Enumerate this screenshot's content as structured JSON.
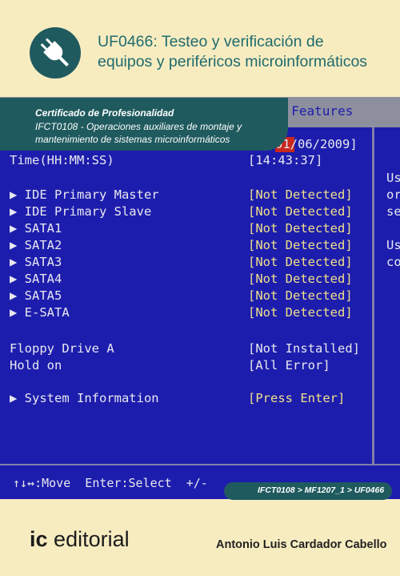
{
  "title": "UF0466: Testeo y verificación de equipos y periféricos microinformáticos",
  "title_line1": "UF0466: Testeo y verificación de",
  "title_line2": "equipos y periféricos microinformáticos",
  "certificate": {
    "heading": "Certificado de Profesionalidad",
    "line1": "IFCT0108 -  Operaciones auxiliares de montaje y",
    "line2": "mantenimiento de sistemas microinformáticos"
  },
  "bios": {
    "header": "S Features",
    "date_value": "01/06/2009]",
    "time_label": "Time(HH:MM:SS)",
    "time_value": "[14:43:37]",
    "rows": [
      {
        "label": "▶ IDE Primary Master",
        "value": "[Not Detected]"
      },
      {
        "label": "▶ IDE Primary Slave",
        "value": "[Not Detected]"
      },
      {
        "label": "▶ SATA1",
        "value": "[Not Detected]"
      },
      {
        "label": "▶ SATA2",
        "value": "[Not Detected]"
      },
      {
        "label": "▶ SATA3",
        "value": "[Not Detected]"
      },
      {
        "label": "▶ SATA4",
        "value": "[Not Detected]"
      },
      {
        "label": "▶ SATA5",
        "value": "[Not Detected]"
      },
      {
        "label": "▶ E-SATA",
        "value": "[Not Detected]"
      }
    ],
    "floppy_label": "Floppy Drive A",
    "floppy_value": "[Not Installed]",
    "hold_label": "Hold on",
    "hold_value": "[All Error]",
    "sysinfo_label": "▶ System Information",
    "sysinfo_value": "[Press Enter]",
    "help_fragments": [
      "Us",
      "or",
      "se",
      "Us",
      "co"
    ],
    "footer": "↑↓↔:Move  Enter:Select  +/-"
  },
  "breadcrumb": "IFCT0108 > MF1207_1 > UF0466",
  "publisher": {
    "prefix": "ic",
    "name": "editorial"
  },
  "author": "Antonio Luis Cardador Cabello",
  "colors": {
    "teal": "#1f5a5e",
    "bios_blue": "#1d1dad",
    "cream": "#f7ecc0",
    "value_yellow": "#f0e08a"
  }
}
